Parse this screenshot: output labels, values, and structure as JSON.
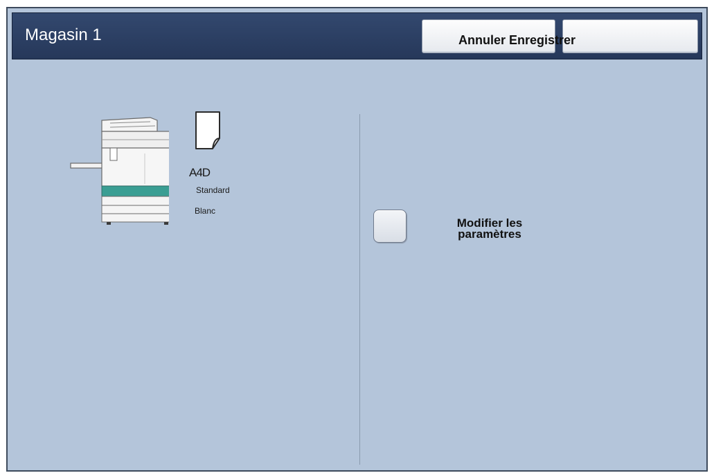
{
  "header": {
    "title": "Magasin 1",
    "buttons_text": "Annuler Enregistrer",
    "cancel_button": "Annuler",
    "save_button": "Enregistrer"
  },
  "tray": {
    "paper_size": "A4D",
    "paper_type": "Standard",
    "paper_color": "Blanc",
    "icons": [
      "printer-icon",
      "paper-sheet-icon"
    ]
  },
  "option": {
    "label_line1": "Modifier les",
    "label_line2": "paramètres",
    "checked": false
  },
  "colors": {
    "background": "#b4c5da",
    "titlebar": "#2c4064",
    "button": "#f2f4f7",
    "accent_teal": "#3a9e93"
  }
}
